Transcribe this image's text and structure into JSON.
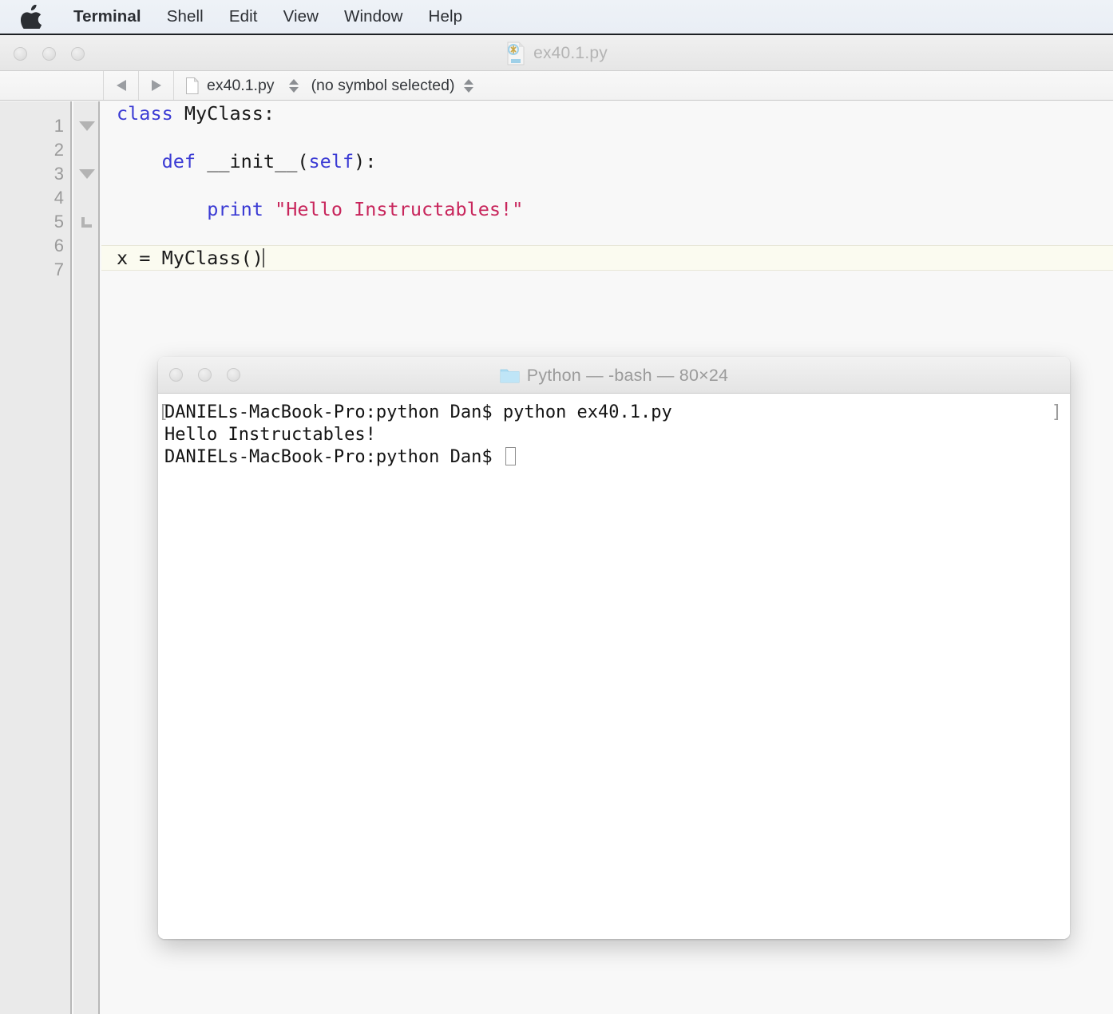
{
  "menubar": {
    "apple_icon": "apple-logo-icon",
    "items": [
      {
        "label": "Terminal",
        "bold": true
      },
      {
        "label": "Shell",
        "bold": false
      },
      {
        "label": "Edit",
        "bold": false
      },
      {
        "label": "View",
        "bold": false
      },
      {
        "label": "Window",
        "bold": false
      },
      {
        "label": "Help",
        "bold": false
      }
    ]
  },
  "editor_window": {
    "title": "ex40.1.py",
    "title_icon": "textedit-document-icon",
    "window_controls": [
      "close-button",
      "minimize-button",
      "zoom-button"
    ],
    "toolbar": {
      "back_icon": "triangle-left-icon",
      "forward_icon": "triangle-right-icon",
      "file_icon": "document-icon",
      "file_label": "ex40.1.py",
      "file_stepper_icon": "stepper-up-down-icon",
      "symbol_label": "(no symbol selected)",
      "symbol_stepper_icon": "stepper-up-down-icon"
    },
    "gutter": {
      "line_numbers": [
        "1",
        "2",
        "3",
        "4",
        "5",
        "6",
        "7"
      ],
      "fold_markers": [
        {
          "line": 1,
          "type": "fold-triangle-icon"
        },
        {
          "line": 3,
          "type": "fold-triangle-icon"
        },
        {
          "line": 5,
          "type": "fold-end-bracket-icon"
        }
      ]
    },
    "code": {
      "current_line": 7,
      "lines": [
        {
          "n": 1,
          "segments": [
            {
              "t": "class ",
              "c": "kw"
            },
            {
              "t": "MyClass:",
              "c": ""
            }
          ]
        },
        {
          "n": 2,
          "segments": [
            {
              "t": "",
              "c": ""
            }
          ]
        },
        {
          "n": 3,
          "segments": [
            {
              "t": "    ",
              "c": ""
            },
            {
              "t": "def ",
              "c": "kw"
            },
            {
              "t": "__init__(",
              "c": ""
            },
            {
              "t": "self",
              "c": "self"
            },
            {
              "t": "):",
              "c": ""
            }
          ]
        },
        {
          "n": 4,
          "segments": [
            {
              "t": "",
              "c": ""
            }
          ]
        },
        {
          "n": 5,
          "segments": [
            {
              "t": "        ",
              "c": ""
            },
            {
              "t": "print ",
              "c": "kw"
            },
            {
              "t": "\"Hello Instructables!\"",
              "c": "str"
            }
          ]
        },
        {
          "n": 6,
          "segments": [
            {
              "t": "",
              "c": ""
            }
          ]
        },
        {
          "n": 7,
          "segments": [
            {
              "t": "x = MyClass()",
              "c": ""
            }
          ]
        }
      ]
    }
  },
  "terminal_window": {
    "title": "Python — -bash — 80×24",
    "title_icon": "folder-icon",
    "window_controls": [
      "close-button",
      "minimize-button",
      "zoom-button"
    ],
    "bracket_left": "[",
    "bracket_right": "]",
    "lines": [
      "DANIELs-MacBook-Pro:python Dan$ python ex40.1.py",
      "Hello Instructables!",
      "DANIELs-MacBook-Pro:python Dan$ "
    ],
    "cursor_icon": "block-cursor-icon"
  },
  "colors": {
    "menubar_bg": "#eef2f7",
    "editor_bg": "#f8f8f8",
    "gutter_bg": "#eaeaea",
    "current_line_bg": "#fbfbf0",
    "keyword": "#3b3bd4",
    "string": "#c8265c",
    "terminal_bg": "#ffffff",
    "terminal_text": "#141414",
    "title_text": "#9b9b9b"
  }
}
